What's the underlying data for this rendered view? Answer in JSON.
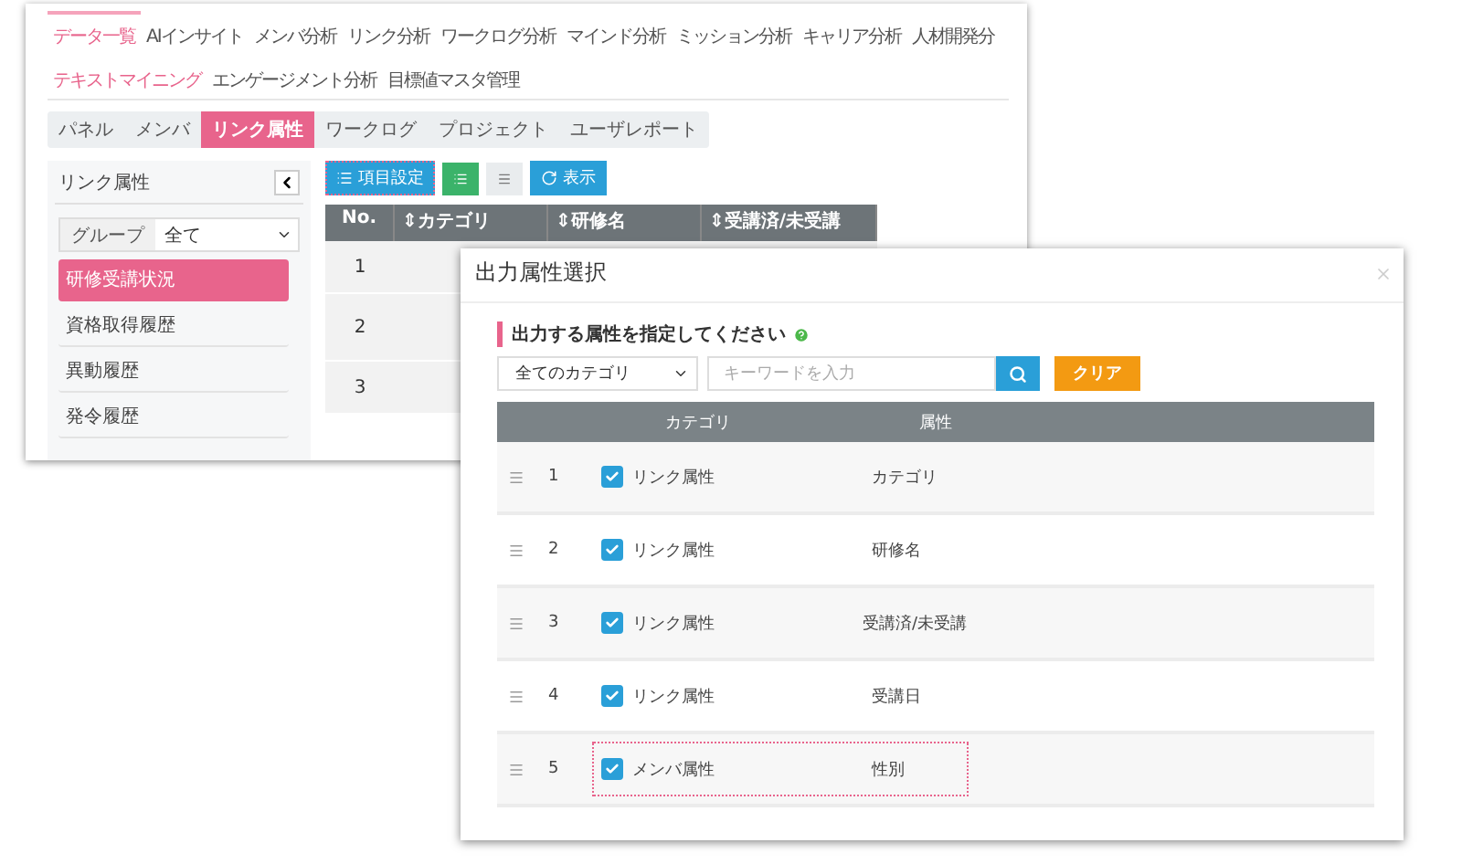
{
  "main_nav": {
    "primary": [
      {
        "label": "データ一覧",
        "selected": true
      },
      {
        "label": "AIインサイト",
        "selected": false
      },
      {
        "label": "メンバ分析",
        "selected": false
      },
      {
        "label": "リンク分析",
        "selected": false
      },
      {
        "label": "ワークログ分析",
        "selected": false
      },
      {
        "label": "マインド分析",
        "selected": false
      },
      {
        "label": "ミッション分析",
        "selected": false
      },
      {
        "label": "キャリア分析",
        "selected": false
      },
      {
        "label": "人材開発分",
        "selected": false
      }
    ],
    "secondary": [
      {
        "label": "テキストマイニング",
        "selected": true
      },
      {
        "label": "エンゲージメント分析",
        "selected": false
      },
      {
        "label": "目標値マスタ管理",
        "selected": false
      }
    ]
  },
  "sub_tabs": [
    {
      "label": "パネル",
      "selected": false
    },
    {
      "label": "メンバ",
      "selected": false
    },
    {
      "label": "リンク属性",
      "selected": true
    },
    {
      "label": "ワークログ",
      "selected": false
    },
    {
      "label": "プロジェクト",
      "selected": false
    },
    {
      "label": "ユーザレポート",
      "selected": false
    }
  ],
  "sidebar": {
    "title": "リンク属性",
    "group_label": "グループ",
    "group_value": "全て",
    "items": [
      {
        "label": "研修受講状況",
        "selected": true
      },
      {
        "label": "資格取得履歴",
        "selected": false
      },
      {
        "label": "異動履歴",
        "selected": false
      },
      {
        "label": "発令履歴",
        "selected": false
      }
    ]
  },
  "toolbar": {
    "settings_button": {
      "label": "項目設定",
      "highlighted": true
    },
    "view_buttons": [
      {
        "kind": "grid",
        "selected": true
      },
      {
        "kind": "list",
        "selected": false
      }
    ],
    "show_button": {
      "label": "表示"
    }
  },
  "table": {
    "columns": [
      "No.",
      "⇕カテゴリ",
      "⇕研修名",
      "⇕受講済/未受講"
    ],
    "rows": [
      {
        "no": "1"
      },
      {
        "no": "2"
      },
      {
        "no": "3"
      }
    ]
  },
  "dialog": {
    "title": "出力属性選択",
    "prompt": "出力する属性を指定してください",
    "category_select": "全てのカテゴリ",
    "keyword": {
      "placeholder": "キーワードを入力"
    },
    "clear_button": "クリア",
    "columns": [
      "カテゴリ",
      "属性"
    ],
    "rows": [
      {
        "no": "1",
        "checked": true,
        "category": "リンク属性",
        "attribute": "カテゴリ",
        "highlighted": false
      },
      {
        "no": "2",
        "checked": true,
        "category": "リンク属性",
        "attribute": "研修名",
        "highlighted": false
      },
      {
        "no": "3",
        "checked": true,
        "category": "リンク属性",
        "attribute": "受講済/未受講",
        "highlighted": false
      },
      {
        "no": "4",
        "checked": true,
        "category": "リンク属性",
        "attribute": "受講日",
        "highlighted": false
      },
      {
        "no": "5",
        "checked": true,
        "category": "メンバ属性",
        "attribute": "性別",
        "highlighted": true
      }
    ]
  }
}
